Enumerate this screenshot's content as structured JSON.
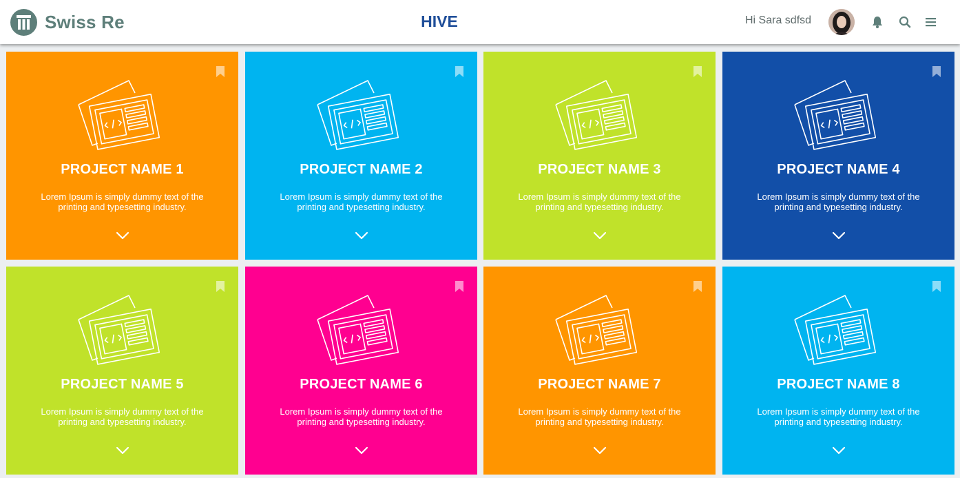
{
  "header": {
    "brand": "Swiss Re",
    "brand_icon": "swiss-re-pillar-logo",
    "app_title": "HIVE",
    "greeting": "Hi Sara sdfsd",
    "icons": [
      "bell-icon",
      "search-icon",
      "menu-icon"
    ],
    "brand_color": "#5e7f7a",
    "title_color": "#1f4e99"
  },
  "projects": [
    {
      "name": "PROJECT NAME 1",
      "description": "Lorem Ipsum is simply dummy text of the printing and typesetting industry.",
      "color": "#ff9500"
    },
    {
      "name": "PROJECT NAME 2",
      "description": "Lorem Ipsum is simply dummy text of the printing and typesetting industry.",
      "color": "#00b4f0"
    },
    {
      "name": "PROJECT NAME 3",
      "description": "Lorem Ipsum is simply dummy text of the printing and typesetting industry.",
      "color": "#c0e22a"
    },
    {
      "name": "PROJECT NAME 4",
      "description": "Lorem Ipsum is simply dummy text of the printing and typesetting industry.",
      "color": "#124fa8"
    },
    {
      "name": "PROJECT NAME 5",
      "description": "Lorem Ipsum is simply dummy text of the printing and typesetting industry.",
      "color": "#c0e22a"
    },
    {
      "name": "PROJECT NAME 6",
      "description": "Lorem Ipsum is simply dummy text of the printing and typesetting industry.",
      "color": "#ff0090"
    },
    {
      "name": "PROJECT NAME 7",
      "description": "Lorem Ipsum is simply dummy text of the printing and typesetting industry.",
      "color": "#ff9500"
    },
    {
      "name": "PROJECT NAME 8",
      "description": "Lorem Ipsum is simply dummy text of the printing and typesetting industry.",
      "color": "#00b4f0"
    }
  ]
}
